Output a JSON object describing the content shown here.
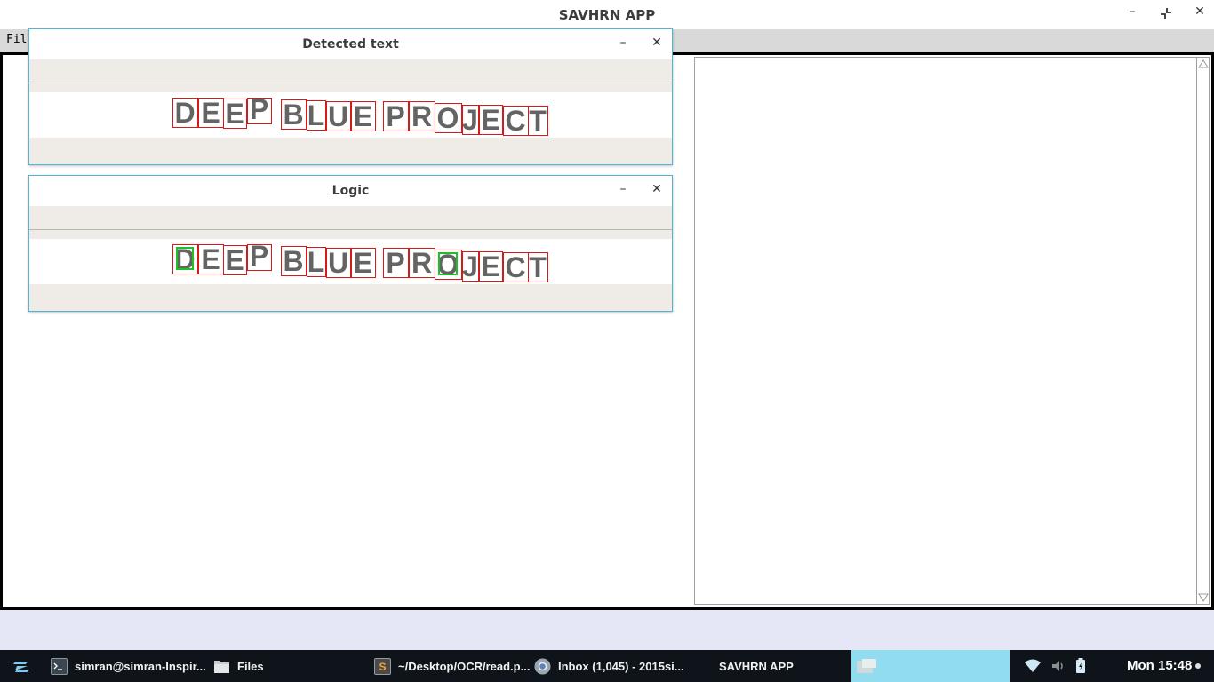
{
  "app": {
    "title": "SAVHRN APP",
    "controls": {
      "minimize": "–",
      "restore": "⤡",
      "close": "✕"
    }
  },
  "menubar": {
    "file_label": "File"
  },
  "subwindows": [
    {
      "title": "Detected text",
      "minimize": "–",
      "close": "✕",
      "image_text": "DEEP BLUE PROJECT",
      "highlighted_letters": []
    },
    {
      "title": "Logic",
      "minimize": "–",
      "close": "✕",
      "image_text": "DEEP BLUE PROJECT",
      "highlighted_letters": [
        "D",
        "O"
      ]
    }
  ],
  "colors": {
    "box_default": "#d61a1a",
    "box_highlight": "#1fbf2a",
    "window_border": "#54b4d2",
    "taskbar_bg": "#0e141a",
    "active_task_bg": "#92dcf0"
  },
  "taskbar": {
    "launcher_icon": "zorin-logo-icon",
    "items": [
      {
        "icon": "terminal-icon",
        "label": "simran@simran-Inspir..."
      },
      {
        "icon": "folder-icon",
        "label": "Files"
      },
      {
        "icon": "sublime-text-icon",
        "label": "~/Desktop/OCR/read.p..."
      },
      {
        "icon": "chrome-icon",
        "label": "Inbox (1,045) - 2015si..."
      },
      {
        "icon": "",
        "label": "SAVHRN APP"
      }
    ],
    "tray_icons": [
      "wifi-icon",
      "volume-icon",
      "battery-icon"
    ],
    "clock": "Mon 15:48"
  }
}
